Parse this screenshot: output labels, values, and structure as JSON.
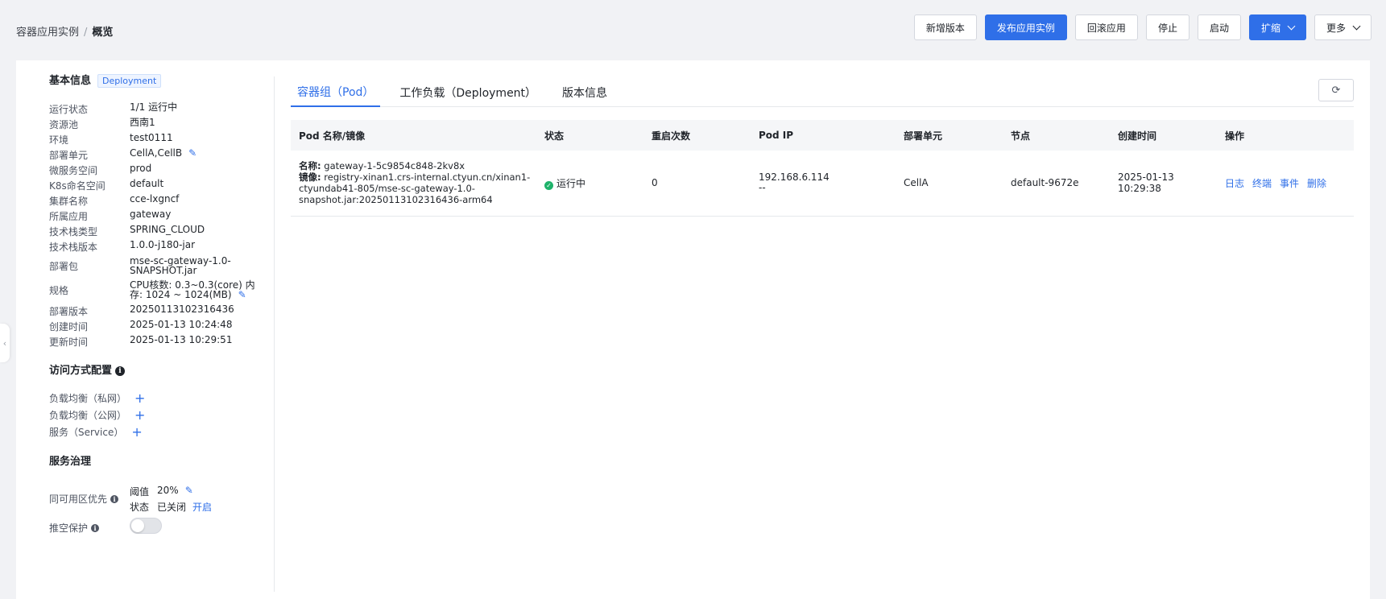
{
  "breadcrumb": {
    "parent": "容器应用实例",
    "separator": "/",
    "current": "概览"
  },
  "toolbar": {
    "add_version": "新增版本",
    "publish": "发布应用实例",
    "rollback": "回滚应用",
    "stop": "停止",
    "start": "启动",
    "scale": "扩缩",
    "more": "更多"
  },
  "basic": {
    "title": "基本信息",
    "badge": "Deployment",
    "rows": [
      {
        "k": "运行状态",
        "v": "1/1 运行中"
      },
      {
        "k": "资源池",
        "v": "西南1"
      },
      {
        "k": "环境",
        "v": "test0111"
      },
      {
        "k": "部署单元",
        "v": "CellA,CellB"
      },
      {
        "k": "微服务空间",
        "v": "prod"
      },
      {
        "k": "K8s命名空间",
        "v": "default"
      },
      {
        "k": "集群名称",
        "v": "cce-lxgncf"
      },
      {
        "k": "所属应用",
        "v": "gateway"
      },
      {
        "k": "技术栈类型",
        "v": "SPRING_CLOUD"
      },
      {
        "k": "技术栈版本",
        "v": "1.0.0-j180-jar"
      },
      {
        "k": "部署包",
        "v1": "mse-sc-gateway-1.0-",
        "v2": "SNAPSHOT.jar"
      },
      {
        "k": "规格",
        "v1": "CPU核数: 0.3~0.3(core) 内",
        "v2": "存: 1024 ~ 1024(MB)"
      },
      {
        "k": "部署版本",
        "v": "20250113102316436"
      },
      {
        "k": "创建时间",
        "v": "2025-01-13 10:24:48"
      },
      {
        "k": "更新时间",
        "v": "2025-01-13 10:29:51"
      }
    ]
  },
  "access": {
    "title": "访问方式配置",
    "items": [
      "负载均衡（私网）",
      "负载均衡（公网）",
      "服务（Service）"
    ]
  },
  "governance": {
    "title": "服务治理",
    "zone_priority_label": "同可用区优先",
    "threshold_label": "阈值",
    "threshold_value": "20%",
    "state_label": "状态",
    "state_value": "已关闭",
    "enable_link": "开启",
    "empty_protect_label": "推空保护",
    "empty_protect_on": false
  },
  "tabs": [
    "容器组（Pod）",
    "工作负载（Deployment）",
    "版本信息"
  ],
  "table": {
    "headers": [
      "Pod 名称/镜像",
      "状态",
      "重启次数",
      "Pod IP",
      "部署单元",
      "节点",
      "创建时间",
      "操作"
    ],
    "rows": [
      {
        "name_label": "名称:",
        "name": "gateway-1-5c9854c848-2kv8x",
        "image_label": "镜像:",
        "image_line1": "registry-xinan1.crs-internal.ctyun.cn/xinan1-",
        "image_line2": "ctyundab41-805/mse-sc-gateway-1.0-",
        "image_line3": "snapshot.jar:20250113102316436-arm64",
        "status": "运行中",
        "restarts": "0",
        "pod_ip": "192.168.6.114",
        "pod_ip_extra": "--",
        "unit": "CellA",
        "node": "default-9672e",
        "created": "2025-01-13 10:29:38",
        "ops": [
          "日志",
          "终端",
          "事件",
          "删除"
        ]
      }
    ]
  }
}
